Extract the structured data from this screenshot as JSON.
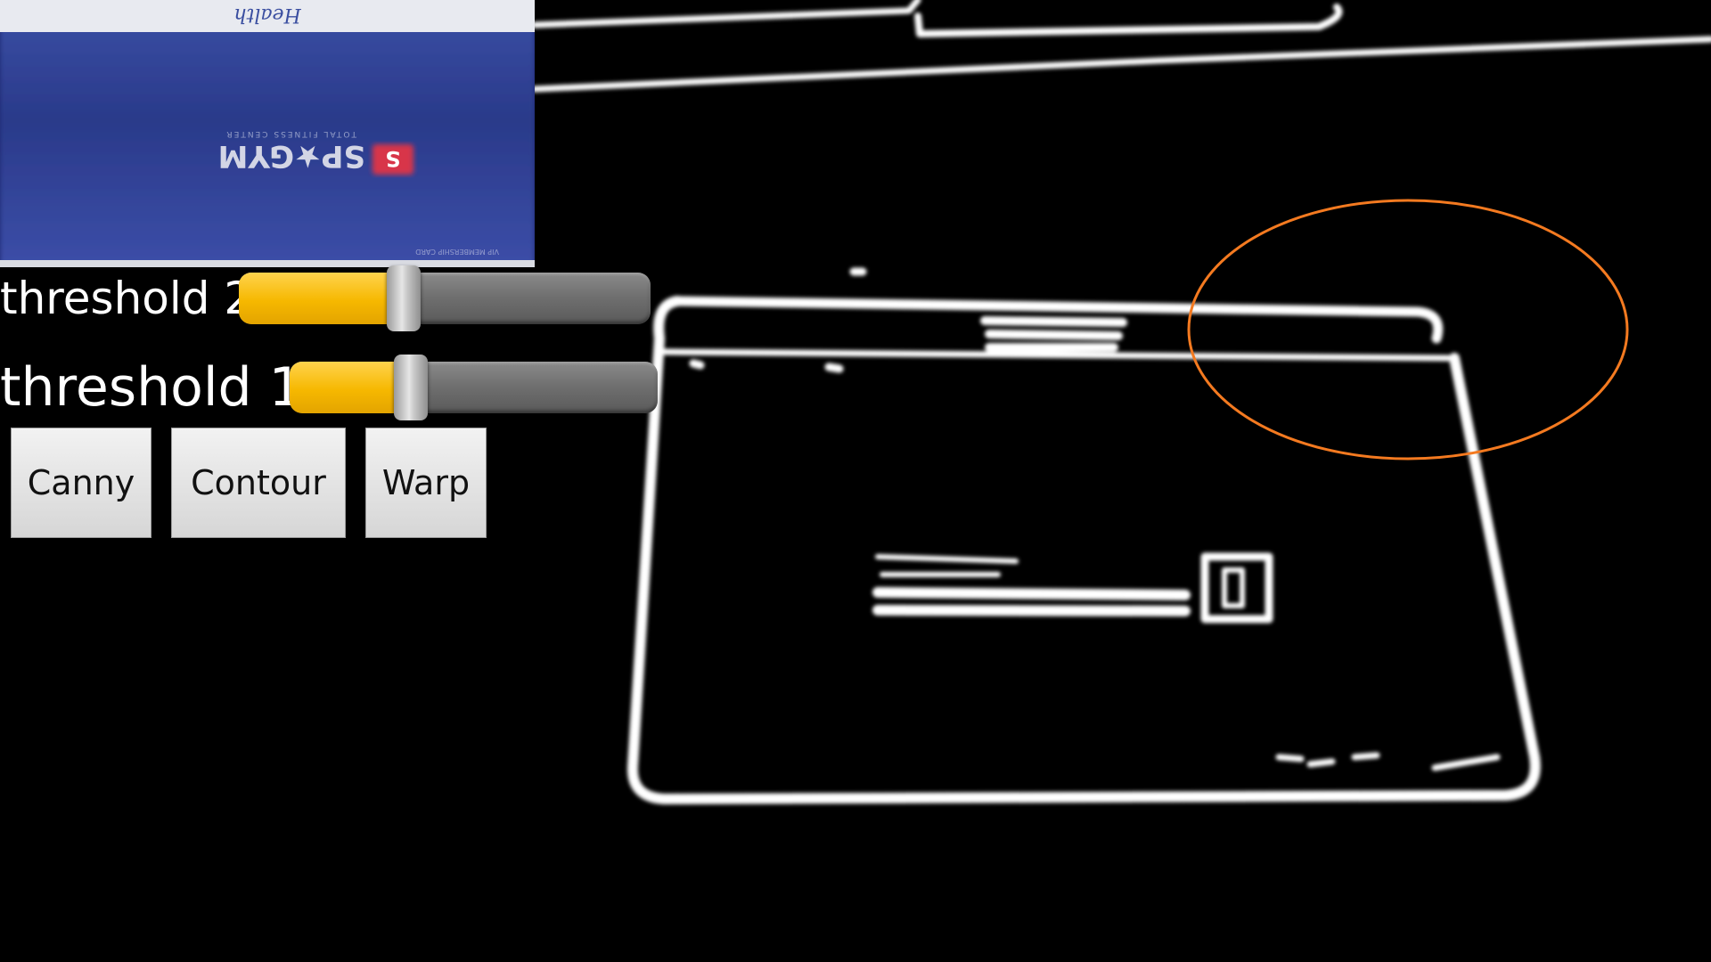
{
  "sliders": {
    "threshold2": {
      "label": "threshold 2",
      "value_fraction": 0.4
    },
    "threshold1": {
      "label": "threshold 1",
      "value_fraction": 0.33
    }
  },
  "buttons": {
    "canny": "Canny",
    "contour": "Contour",
    "warp": "Warp"
  },
  "preview": {
    "card_script_text": "Health",
    "card_brand": "SP★GYM",
    "card_logo_letter": "S",
    "card_tagline": "TOTAL FITNESS CENTER",
    "card_footer": "VIP MEMBERSHIP CARD"
  },
  "colors": {
    "background": "#000000",
    "edges": "#ffffff",
    "slider_fill": "#f6b800",
    "highlight_ellipse": "#f47a20",
    "card_blue": "#2c3d8e"
  }
}
